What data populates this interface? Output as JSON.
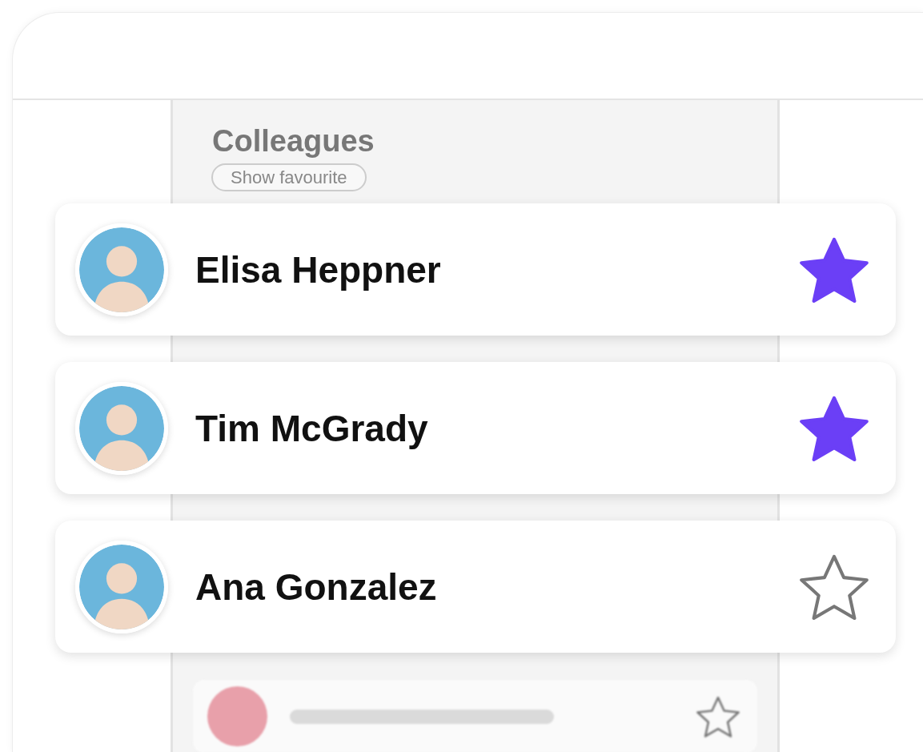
{
  "panel": {
    "title": "Colleagues",
    "filter_button": "Show favourite"
  },
  "contacts": [
    {
      "name": "Elisa Heppner",
      "favourite": true
    },
    {
      "name": "Tim McGrady",
      "favourite": true
    },
    {
      "name": "Ana Gonzalez",
      "favourite": false
    }
  ]
}
